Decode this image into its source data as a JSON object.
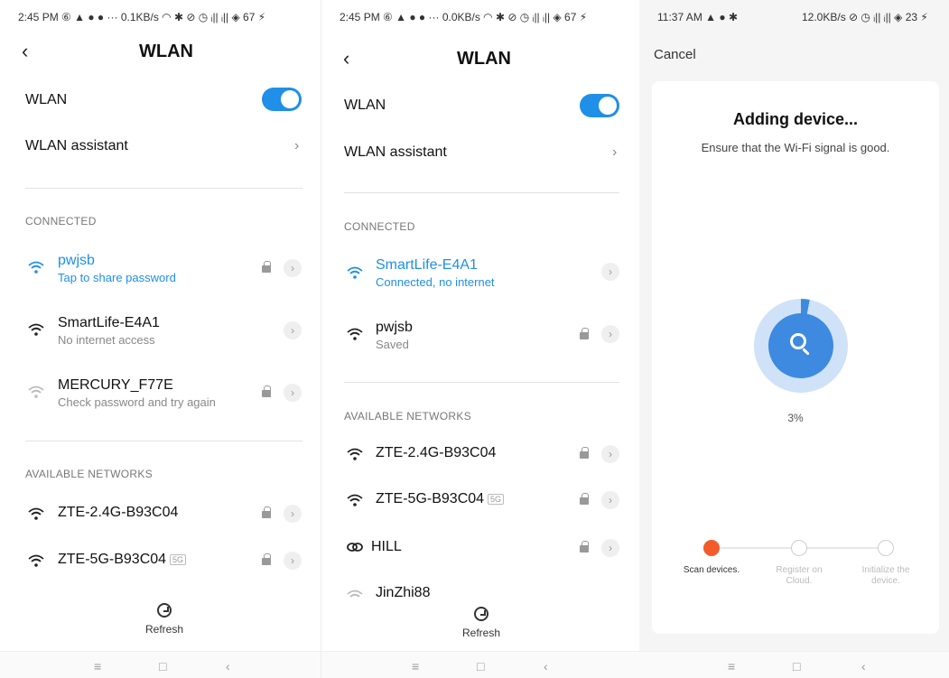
{
  "panel1": {
    "status": "2:45 PM ⑥ ▲ ● ● ··· 0.1KB/s ◠ ✱ ⊘ ◷ ᵢ|| ᵢ|| ◈ 67 ⚡",
    "title": "WLAN",
    "wlan_label": "WLAN",
    "assistant_label": "WLAN assistant",
    "connected_header": "CONNECTED",
    "connected": [
      {
        "name": "pwjsb",
        "sub": "Tap to share password",
        "locked": true,
        "active": true
      },
      {
        "name": "SmartLife-E4A1",
        "sub": "No internet access",
        "locked": false,
        "active": false
      },
      {
        "name": "MERCURY_F77E",
        "sub": "Check password and try again",
        "locked": true,
        "active": false
      }
    ],
    "available_header": "AVAILABLE NETWORKS",
    "available": [
      {
        "name": "ZTE-2.4G-B93C04",
        "badge": ""
      },
      {
        "name": "ZTE-5G-B93C04",
        "badge": "5G"
      }
    ],
    "refresh": "Refresh"
  },
  "panel2": {
    "status": "2:45 PM ⑥ ▲ ● ● ··· 0.0KB/s ◠ ✱ ⊘ ◷ ᵢ|| ᵢ|| ◈ 67 ⚡",
    "title": "WLAN",
    "wlan_label": "WLAN",
    "assistant_label": "WLAN assistant",
    "connected_header": "CONNECTED",
    "connected": [
      {
        "name": "SmartLife-E4A1",
        "sub": "Connected, no internet",
        "active": true
      },
      {
        "name": "pwjsb",
        "sub": "Saved",
        "active": false
      }
    ],
    "available_header": "AVAILABLE NETWORKS",
    "available": [
      {
        "name": "ZTE-2.4G-B93C04",
        "badge": ""
      },
      {
        "name": "ZTE-5G-B93C04",
        "badge": "5G"
      },
      {
        "name": "HILL",
        "badge": ""
      },
      {
        "name": "JinZhi88",
        "badge": ""
      }
    ],
    "refresh": "Refresh"
  },
  "panel3": {
    "status": "11:37 AM ▲ ● ✱",
    "status_right": "12.0KB/s ⊘ ◷ ᵢ|| ᵢ|| ◈ 23 ⚡",
    "cancel": "Cancel",
    "title": "Adding device...",
    "subtitle": "Ensure that the Wi-Fi signal is good.",
    "progress_label": "3%",
    "progress_value": 0.03,
    "steps": [
      {
        "label": "Scan devices."
      },
      {
        "label": "Register on Cloud."
      },
      {
        "label": "Initialize the device."
      }
    ]
  },
  "colors": {
    "accent": "#1f8fe8",
    "progress": "#3e8ae0",
    "step_active": "#f25c2a"
  }
}
